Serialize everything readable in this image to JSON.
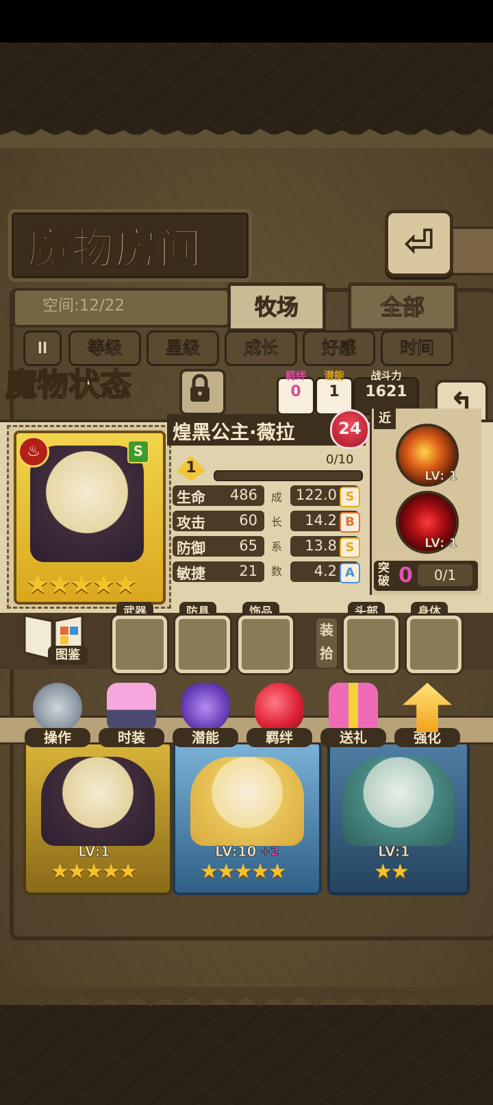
{
  "header": {
    "title": "魔物房间",
    "back_glyph": "⏎"
  },
  "storage": {
    "label": "空间:12/22"
  },
  "tabs": [
    {
      "label": "牧场",
      "active": true
    },
    {
      "label": "全部",
      "active": false
    }
  ],
  "filters": {
    "toggle": "Ⅱ",
    "items": [
      "等级",
      "星级",
      "成长",
      "好感",
      "时间"
    ]
  },
  "status": {
    "title": "魔物状态",
    "pills": [
      {
        "label": "羁绊",
        "value": "0",
        "color": "#d64a9e"
      },
      {
        "label": "潜能",
        "value": "1",
        "color": "#d9a21e"
      },
      {
        "label": "战斗力",
        "value": "1621",
        "color": "#f2e6c6"
      }
    ],
    "back_glyph": "↰"
  },
  "monster": {
    "name": "煌黑公主·薇拉",
    "level": "24",
    "element_icon": "fire-icon",
    "rank": "S",
    "stars": "★★★★★",
    "potential": "1",
    "exp": "0/10",
    "exp_fraction": 0,
    "stats": [
      {
        "label": "生命",
        "value": "486",
        "growth": "122.0",
        "grade": "S",
        "grade_color": "#e6a91b"
      },
      {
        "label": "攻击",
        "value": "60",
        "growth": "14.2",
        "grade": "B",
        "grade_color": "#e3732c"
      },
      {
        "label": "防御",
        "value": "65",
        "growth": "13.8",
        "grade": "S",
        "grade_color": "#e6a91b"
      },
      {
        "label": "敏捷",
        "value": "21",
        "growth": "4.2",
        "grade": "A",
        "grade_color": "#4a8fd6"
      }
    ],
    "growth_caption": [
      "成",
      "长",
      "系",
      "数"
    ]
  },
  "skills": {
    "range_label": "近",
    "items": [
      {
        "icon": "fire-slash-icon",
        "level": "LV: 1"
      },
      {
        "icon": "dark-vortex-icon",
        "level": "LV: 1"
      }
    ],
    "breakthrough_label": "突破",
    "breakthrough_value": "0",
    "breakthrough_progress": "0/1"
  },
  "equipment": {
    "codex_label": "图鉴",
    "slots": [
      {
        "label": "武器"
      },
      {
        "label": "防具"
      },
      {
        "label": "饰品"
      },
      {
        "label": "头部"
      },
      {
        "label": "身体"
      }
    ],
    "pickup_label": "装拾"
  },
  "actions": [
    {
      "label": "操作",
      "icon": "gear-icon"
    },
    {
      "label": "时装",
      "icon": "outfit-icon"
    },
    {
      "label": "潜能",
      "icon": "demon-icon"
    },
    {
      "label": "羁绊",
      "icon": "hearts-icon"
    },
    {
      "label": "送礼",
      "icon": "gift-icon"
    },
    {
      "label": "强化",
      "icon": "upgrade-arrows-icon"
    }
  ],
  "roster": [
    {
      "level": "LV:1",
      "bonus": "",
      "stars": "★★★★★",
      "frame": "#c9a227"
    },
    {
      "level": "LV:10",
      "bonus": "+2",
      "stars": "★★★★★",
      "frame": "#4a88b8"
    },
    {
      "level": "LV:1",
      "bonus": "",
      "stars": "★★",
      "frame": "#3c6a92"
    }
  ]
}
